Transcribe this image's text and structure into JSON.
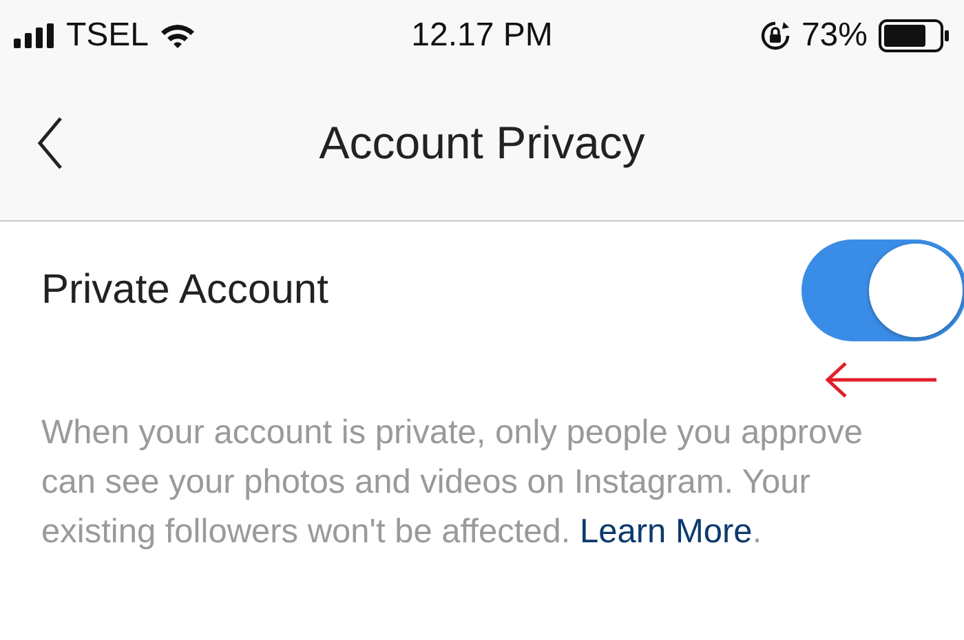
{
  "status_bar": {
    "carrier": "TSEL",
    "time": "12.17 PM",
    "battery": "73%"
  },
  "nav": {
    "title": "Account Privacy"
  },
  "setting": {
    "label": "Private Account",
    "on": true
  },
  "description": {
    "text": "When your account is private, only people you approve can see your photos and videos on Instagram. Your existing followers won't be affected.",
    "link": "Learn More",
    "suffix": "."
  }
}
